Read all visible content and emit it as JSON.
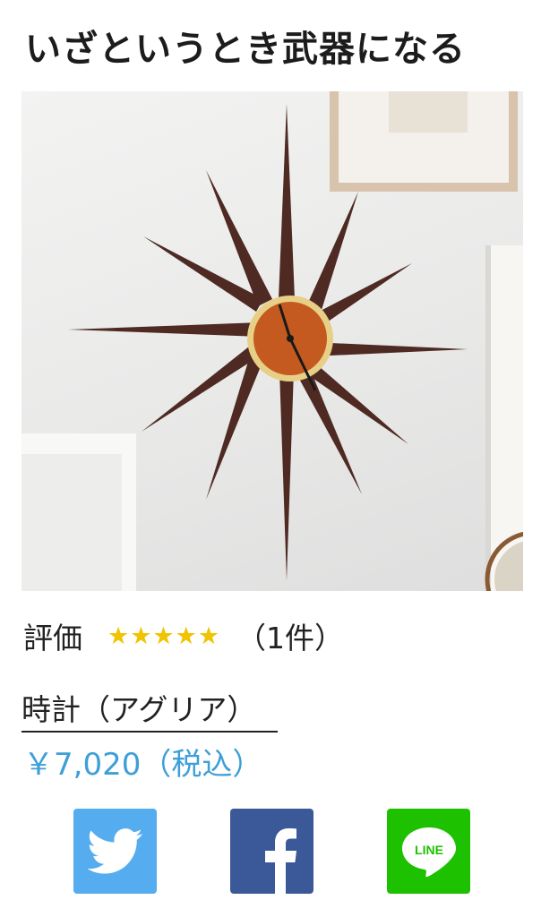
{
  "title": "いざというとき武器になる",
  "rating": {
    "label": "評価",
    "stars": "★★★★★",
    "count": "（1件）"
  },
  "product": {
    "name": "時計（アグリア）",
    "price": "￥7,020（税込）"
  },
  "share": {
    "line_text": "LINE"
  },
  "colors": {
    "price": "#3d9fd8",
    "twitter": "#55acee",
    "facebook": "#3b5998",
    "line": "#1dc100",
    "star": "#f0c400"
  },
  "icons": [
    "twitter-icon",
    "facebook-icon",
    "line-icon"
  ]
}
